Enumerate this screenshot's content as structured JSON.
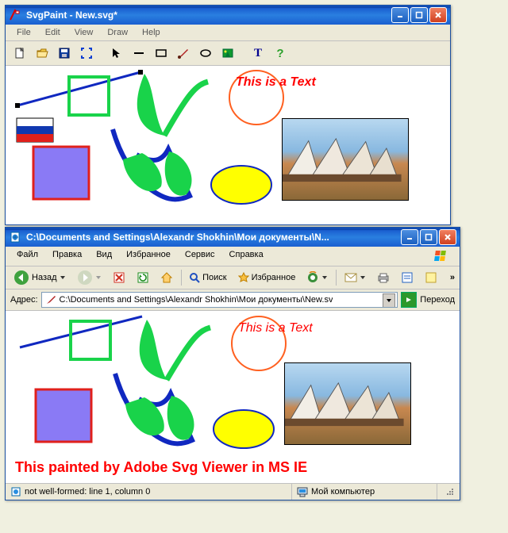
{
  "app": {
    "title": "SvgPaint - New.svg*",
    "menu": [
      "File",
      "Edit",
      "View",
      "Draw",
      "Help"
    ],
    "toolbar_names": [
      "new",
      "open",
      "save",
      "fullscreen",
      "pointer",
      "line",
      "rect",
      "brush",
      "ellipse",
      "image",
      "text",
      "help"
    ],
    "canvas_text": "This is a Text"
  },
  "ie": {
    "title": "C:\\Documents and Settings\\Alexandr Shokhin\\Мои документы\\N...",
    "menu": [
      "Файл",
      "Правка",
      "Вид",
      "Избранное",
      "Сервис",
      "Справка"
    ],
    "nav": {
      "back": "Назад",
      "search": "Поиск",
      "favorites": "Избранное"
    },
    "address_label": "Адрес:",
    "address_value": "C:\\Documents and Settings\\Alexandr Shokhin\\Мои документы\\New.sv",
    "go_label": "Переход",
    "canvas_text": "This is a Text",
    "caption": "This painted by Adobe Svg Viewer in  MS IE",
    "status_left": "not well-formed: line 1, column 0",
    "status_right": "Мой компьютер"
  }
}
